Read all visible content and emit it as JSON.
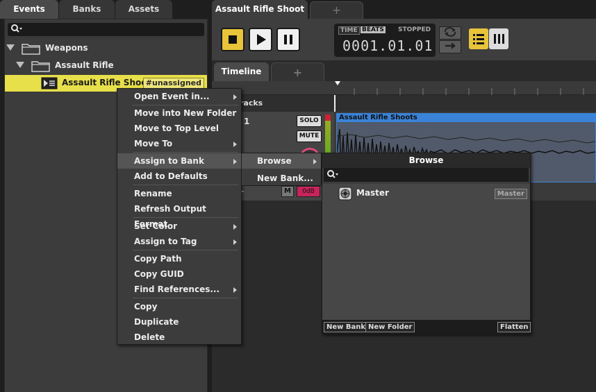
{
  "left_tabs": [
    {
      "label": "Events",
      "active": true
    },
    {
      "label": "Banks",
      "active": false
    },
    {
      "label": "Assets",
      "active": false
    }
  ],
  "tree": [
    {
      "label": "Weapons",
      "type": "folder"
    },
    {
      "label": "Assault Rifle",
      "type": "folder"
    },
    {
      "label": "Assault Rifle Shoot",
      "type": "event",
      "badge": "#unassigned"
    }
  ],
  "editor": {
    "tab_title": "Assault Rifle Shoot",
    "add_tab": "+",
    "transport": {
      "time_label": "TIME",
      "beats_label": "BEATS",
      "status": "STOPPED",
      "position": "0001.01.01"
    },
    "sub_tabs": [
      {
        "label": "Timeline"
      },
      {
        "label": "+"
      }
    ],
    "tracks_label": "racks",
    "track": {
      "number": "1",
      "solo": "SOLO",
      "mute": "MUTE",
      "m_label": "M",
      "gain": "0dB",
      "partial_label": "r"
    },
    "region_name": "Assault Rifle Shoots"
  },
  "context_menu": {
    "groups": [
      [
        {
          "label": "Open Event in...",
          "has_sub": true
        }
      ],
      [
        {
          "label": "Move into New Folder",
          "has_sub": false
        },
        {
          "label": "Move to Top Level",
          "has_sub": false
        },
        {
          "label": "Move To",
          "has_sub": true
        }
      ],
      [
        {
          "label": "Assign to Bank",
          "has_sub": true,
          "hover": true
        },
        {
          "label": "Add to Defaults",
          "has_sub": false
        }
      ],
      [
        {
          "label": "Rename",
          "has_sub": false
        },
        {
          "label": "Refresh Output Format",
          "has_sub": false
        }
      ],
      [
        {
          "label": "Set Color",
          "has_sub": true
        },
        {
          "label": "Assign to Tag",
          "has_sub": true
        }
      ],
      [
        {
          "label": "Copy Path",
          "has_sub": false
        },
        {
          "label": "Copy GUID",
          "has_sub": false
        },
        {
          "label": "Find References...",
          "has_sub": true
        }
      ],
      [
        {
          "label": "Copy",
          "has_sub": false
        },
        {
          "label": "Duplicate",
          "has_sub": false
        },
        {
          "label": "Delete",
          "has_sub": false
        }
      ]
    ]
  },
  "assign_submenu": {
    "items": [
      {
        "label": "Browse",
        "has_sub": true,
        "hover": true
      },
      {
        "label": "New Bank...",
        "has_sub": false
      }
    ]
  },
  "browse_panel": {
    "title": "Browse",
    "banks": [
      {
        "label": "Master",
        "tag": "Master"
      }
    ],
    "footer": {
      "new_bank": "New Bank",
      "new_folder": "New Folder",
      "flatten": "Flatten"
    }
  },
  "colors": {
    "selection_yellow": "#e8e04a",
    "region_blue": "#3a83d8",
    "stop_yellow": "#e8c43a"
  }
}
